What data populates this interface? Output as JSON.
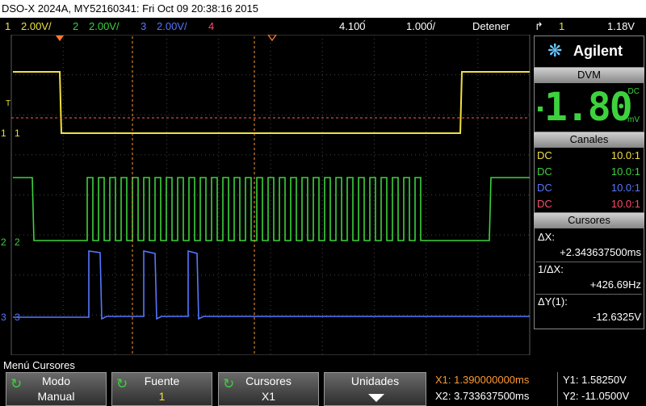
{
  "title": "DSO-X 2024A, MY52160341: Fri Oct 09 20:38:16 2015",
  "channels_bar": {
    "ch1_num": "1",
    "ch1_scale": "2.00V/",
    "ch2_num": "2",
    "ch2_scale": "2.00V/",
    "ch3_num": "3",
    "ch3_scale": "2.00V/",
    "ch4_num": "4",
    "delay": "4.100́",
    "timebase": "1.000́/",
    "run_state": "Detener",
    "trigger_source": "1",
    "trigger_level": "1.18V"
  },
  "brand": "Agilent",
  "dvm": {
    "header": "DVM",
    "unit_top": "DC",
    "unit_bottom": "mV",
    "reading": "1.80"
  },
  "channels_panel": {
    "header": "Canales",
    "rows": [
      {
        "coupling": "DC",
        "probe": "10.0:1",
        "color": "#f0e040"
      },
      {
        "coupling": "DC",
        "probe": "10.0:1",
        "color": "#3dd23d"
      },
      {
        "coupling": "DC",
        "probe": "10.0:1",
        "color": "#5577ff"
      },
      {
        "coupling": "DC",
        "probe": "10.0:1",
        "color": "#ff4a6a"
      }
    ]
  },
  "cursors_panel": {
    "header": "Cursores",
    "dx_label": "ΔX:",
    "dx_value": "+2.343637500ms",
    "inv_dx_label": "1/ΔX:",
    "inv_dx_value": "+426.69Hz",
    "dy_label": "ΔY(1):",
    "dy_value": "-12.6325V"
  },
  "markers": {
    "ch1": "1",
    "ch2": "2",
    "ch3": "3",
    "trigger": "T"
  },
  "softkeys": {
    "menu_title": "Menú Cursores",
    "mode_label": "Modo",
    "mode_value": "Manual",
    "source_label": "Fuente",
    "source_value": "1",
    "cursors_label": "Cursores",
    "cursors_value": "X1",
    "units_label": "Unidades"
  },
  "cursor_readout": {
    "x1": "X1: 1.390000000ms",
    "x2": "X2: 3.733637500ms",
    "y1": "Y1: 1.58250V",
    "y2": "Y2: -11.0500V"
  },
  "colors": {
    "ch1": "#f0e040",
    "ch2": "#3dd23d",
    "ch3": "#5577ff",
    "ch4": "#ff4a6a",
    "cursor": "#ff9a30",
    "trigger": "#ff7a30"
  }
}
